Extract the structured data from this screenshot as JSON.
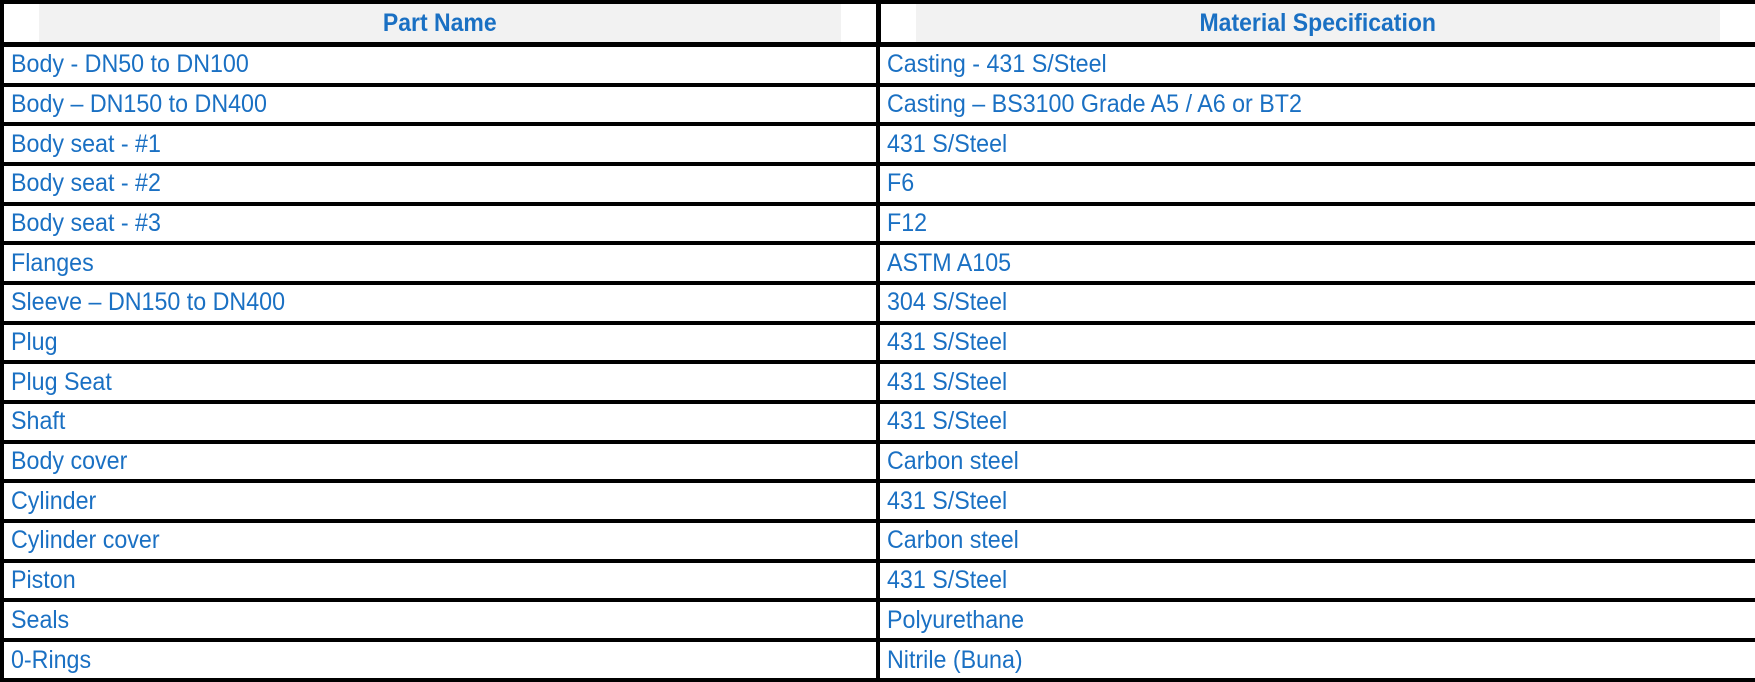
{
  "table": {
    "columns": [
      {
        "key": "part_name",
        "label": "Part Name"
      },
      {
        "key": "material_specification",
        "label": "Material Specification"
      }
    ],
    "header_text_color": "#1a70c3",
    "header_background": "#f2f2f2",
    "body_text_color": "#1a70c3",
    "border_color": "#000000",
    "rows": [
      {
        "part_name": "Body - DN50 to DN100",
        "material_specification": "Casting - 431 S/Steel"
      },
      {
        "part_name": "Body – DN150 to DN400",
        "material_specification": "Casting – BS3100 Grade A5 / A6 or BT2"
      },
      {
        "part_name": "Body seat - #1",
        "material_specification": "431 S/Steel"
      },
      {
        "part_name": "Body seat - #2",
        "material_specification": "F6"
      },
      {
        "part_name": "Body seat - #3",
        "material_specification": "F12"
      },
      {
        "part_name": "Flanges",
        "material_specification": "ASTM A105"
      },
      {
        "part_name": "Sleeve – DN150 to DN400",
        "material_specification": "304 S/Steel"
      },
      {
        "part_name": "Plug",
        "material_specification": "431 S/Steel"
      },
      {
        "part_name": "Plug Seat",
        "material_specification": "431 S/Steel"
      },
      {
        "part_name": "Shaft",
        "material_specification": "431 S/Steel"
      },
      {
        "part_name": "Body cover",
        "material_specification": "Carbon steel"
      },
      {
        "part_name": "Cylinder",
        "material_specification": "431 S/Steel"
      },
      {
        "part_name": "Cylinder cover",
        "material_specification": "Carbon steel"
      },
      {
        "part_name": "Piston",
        "material_specification": "431 S/Steel"
      },
      {
        "part_name": "Seals",
        "material_specification": "Polyurethane"
      },
      {
        "part_name": "0-Rings",
        "material_specification": "Nitrile (Buna)"
      }
    ]
  }
}
